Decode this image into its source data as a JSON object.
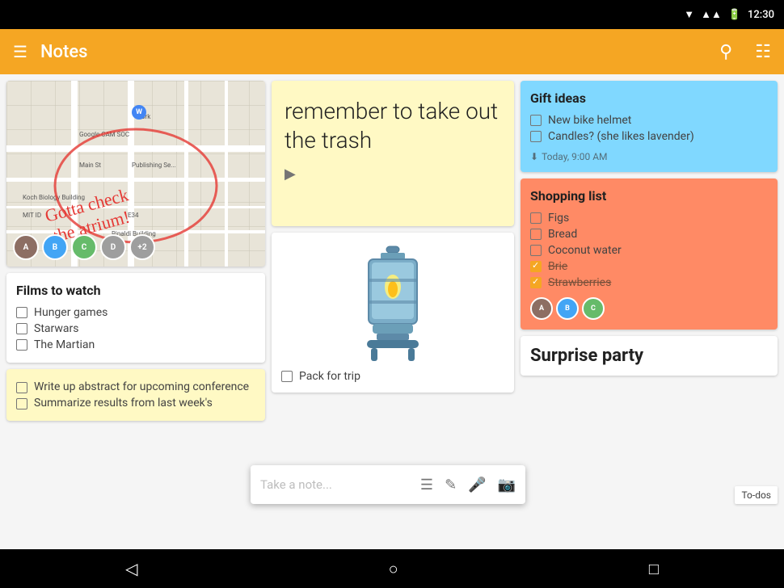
{
  "statusBar": {
    "time": "12:30",
    "icons": [
      "wifi",
      "signal",
      "battery"
    ]
  },
  "appBar": {
    "title": "Notes",
    "menuIcon": "☰",
    "searchIcon": "🔍",
    "viewIcon": "⊟"
  },
  "mapCard": {
    "annotation": "Gotta check the atrium!",
    "labels": [
      "Google CAM SOC",
      "Work",
      "Main St",
      "Publishing Se...",
      "Koch Biology Building",
      "MIT ID",
      "E34",
      "Rinaldi Building"
    ],
    "avatarCount": "+2"
  },
  "filmsCard": {
    "title": "Films to watch",
    "items": [
      {
        "text": "Hunger games",
        "checked": false
      },
      {
        "text": "Starwars",
        "checked": false
      },
      {
        "text": "The Martian",
        "checked": false
      }
    ]
  },
  "todoCard": {
    "items": [
      {
        "text": "Write up abstract for upcoming conference",
        "checked": false
      },
      {
        "text": "Summarize results from last week's",
        "checked": false
      }
    ]
  },
  "bigNote": {
    "text": "remember to take out the trash",
    "playButton": "▶"
  },
  "lanternCard": {
    "packItem": "Pack for trip"
  },
  "takeNoteBar": {
    "placeholder": "Take a note...",
    "icons": [
      "list",
      "brush",
      "mic",
      "camera"
    ]
  },
  "giftCard": {
    "title": "Gift ideas",
    "items": [
      {
        "text": "New bike helmet",
        "checked": false
      },
      {
        "text": "Candles? (she likes lavender)",
        "checked": false
      }
    ],
    "timestamp": "Today, 9:00 AM"
  },
  "shoppingCard": {
    "title": "Shopping list",
    "items": [
      {
        "text": "Figs",
        "checked": false
      },
      {
        "text": "Bread",
        "checked": false
      },
      {
        "text": "Coconut water",
        "checked": false
      },
      {
        "text": "Brie",
        "checked": true,
        "strikethrough": true
      },
      {
        "text": "Strawberries",
        "checked": true,
        "strikethrough": true
      }
    ]
  },
  "surpriseCard": {
    "title": "Surprise party"
  },
  "todosLabel": "To-dos",
  "bottomNav": {
    "back": "◁",
    "home": "○",
    "recent": "□"
  }
}
